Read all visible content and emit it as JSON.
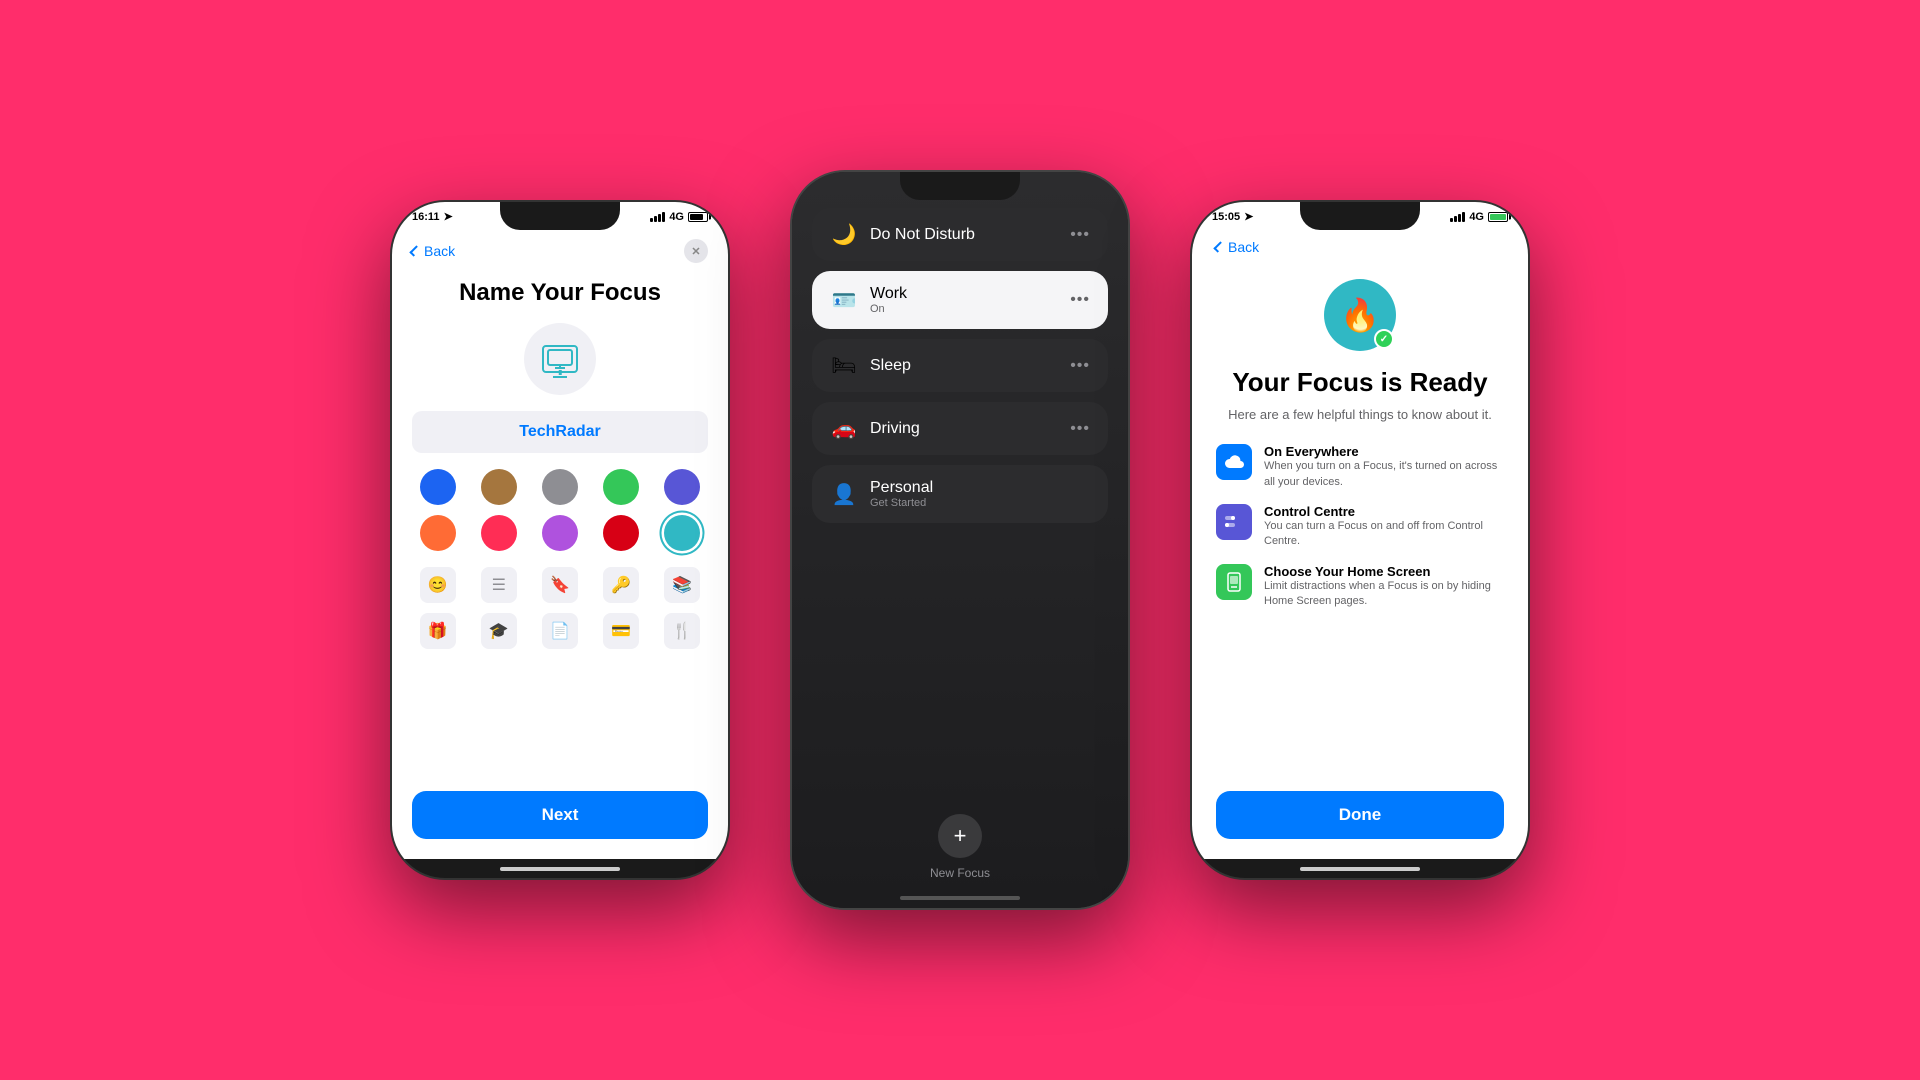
{
  "bg_color": "#FF2D6B",
  "phone1": {
    "status": {
      "time": "16:11",
      "signal": "4G",
      "battery": 80
    },
    "back_label": "Back",
    "close_label": "✕",
    "title": "Name Your Focus",
    "input_value": "TechRadar",
    "next_label": "Next",
    "colors": [
      {
        "hex": "#1C64F2",
        "selected": false
      },
      {
        "hex": "#A5763E",
        "selected": false
      },
      {
        "hex": "#8E8E93",
        "selected": false
      },
      {
        "hex": "#34C759",
        "selected": false
      },
      {
        "hex": "#5856D6",
        "selected": false
      },
      {
        "hex": "#FF6B35",
        "selected": false
      },
      {
        "hex": "#FF2D55",
        "selected": false
      },
      {
        "hex": "#AF52DE",
        "selected": false
      },
      {
        "hex": "#D70015",
        "selected": false
      },
      {
        "hex": "#30B8C4",
        "selected": true
      }
    ],
    "icons": [
      "😊",
      "☰",
      "🔖",
      "🔑",
      "📚",
      "🎁",
      "🎓",
      "📄",
      "💳",
      "🍴"
    ]
  },
  "phone2": {
    "focus_items": [
      {
        "name": "Do Not Disturb",
        "sub": "",
        "icon": "🌙",
        "active": false
      },
      {
        "name": "Work",
        "sub": "On",
        "icon": "🪪",
        "active": true
      },
      {
        "name": "Sleep",
        "sub": "",
        "icon": "🛏",
        "active": false
      },
      {
        "name": "Driving",
        "sub": "",
        "icon": "🚗",
        "active": false
      },
      {
        "name": "Personal",
        "sub": "Get Started",
        "icon": "👤",
        "active": false
      }
    ],
    "add_label": "+",
    "new_focus_label": "New Focus"
  },
  "phone3": {
    "status": {
      "time": "15:05",
      "signal": "4G",
      "battery": 100
    },
    "back_label": "Back",
    "title": "Your Focus is Ready",
    "subtitle": "Here are a few helpful things to know about it.",
    "features": [
      {
        "title": "On Everywhere",
        "desc": "When you turn on a Focus, it's turned on across all your devices.",
        "icon": "☁",
        "color": "blue"
      },
      {
        "title": "Control Centre",
        "desc": "You can turn a Focus on and off from Control Centre.",
        "icon": "⊞",
        "color": "indigo"
      },
      {
        "title": "Choose Your Home Screen",
        "desc": "Limit distractions when a Focus is on by hiding Home Screen pages.",
        "icon": "📱",
        "color": "green"
      }
    ],
    "done_label": "Done"
  }
}
